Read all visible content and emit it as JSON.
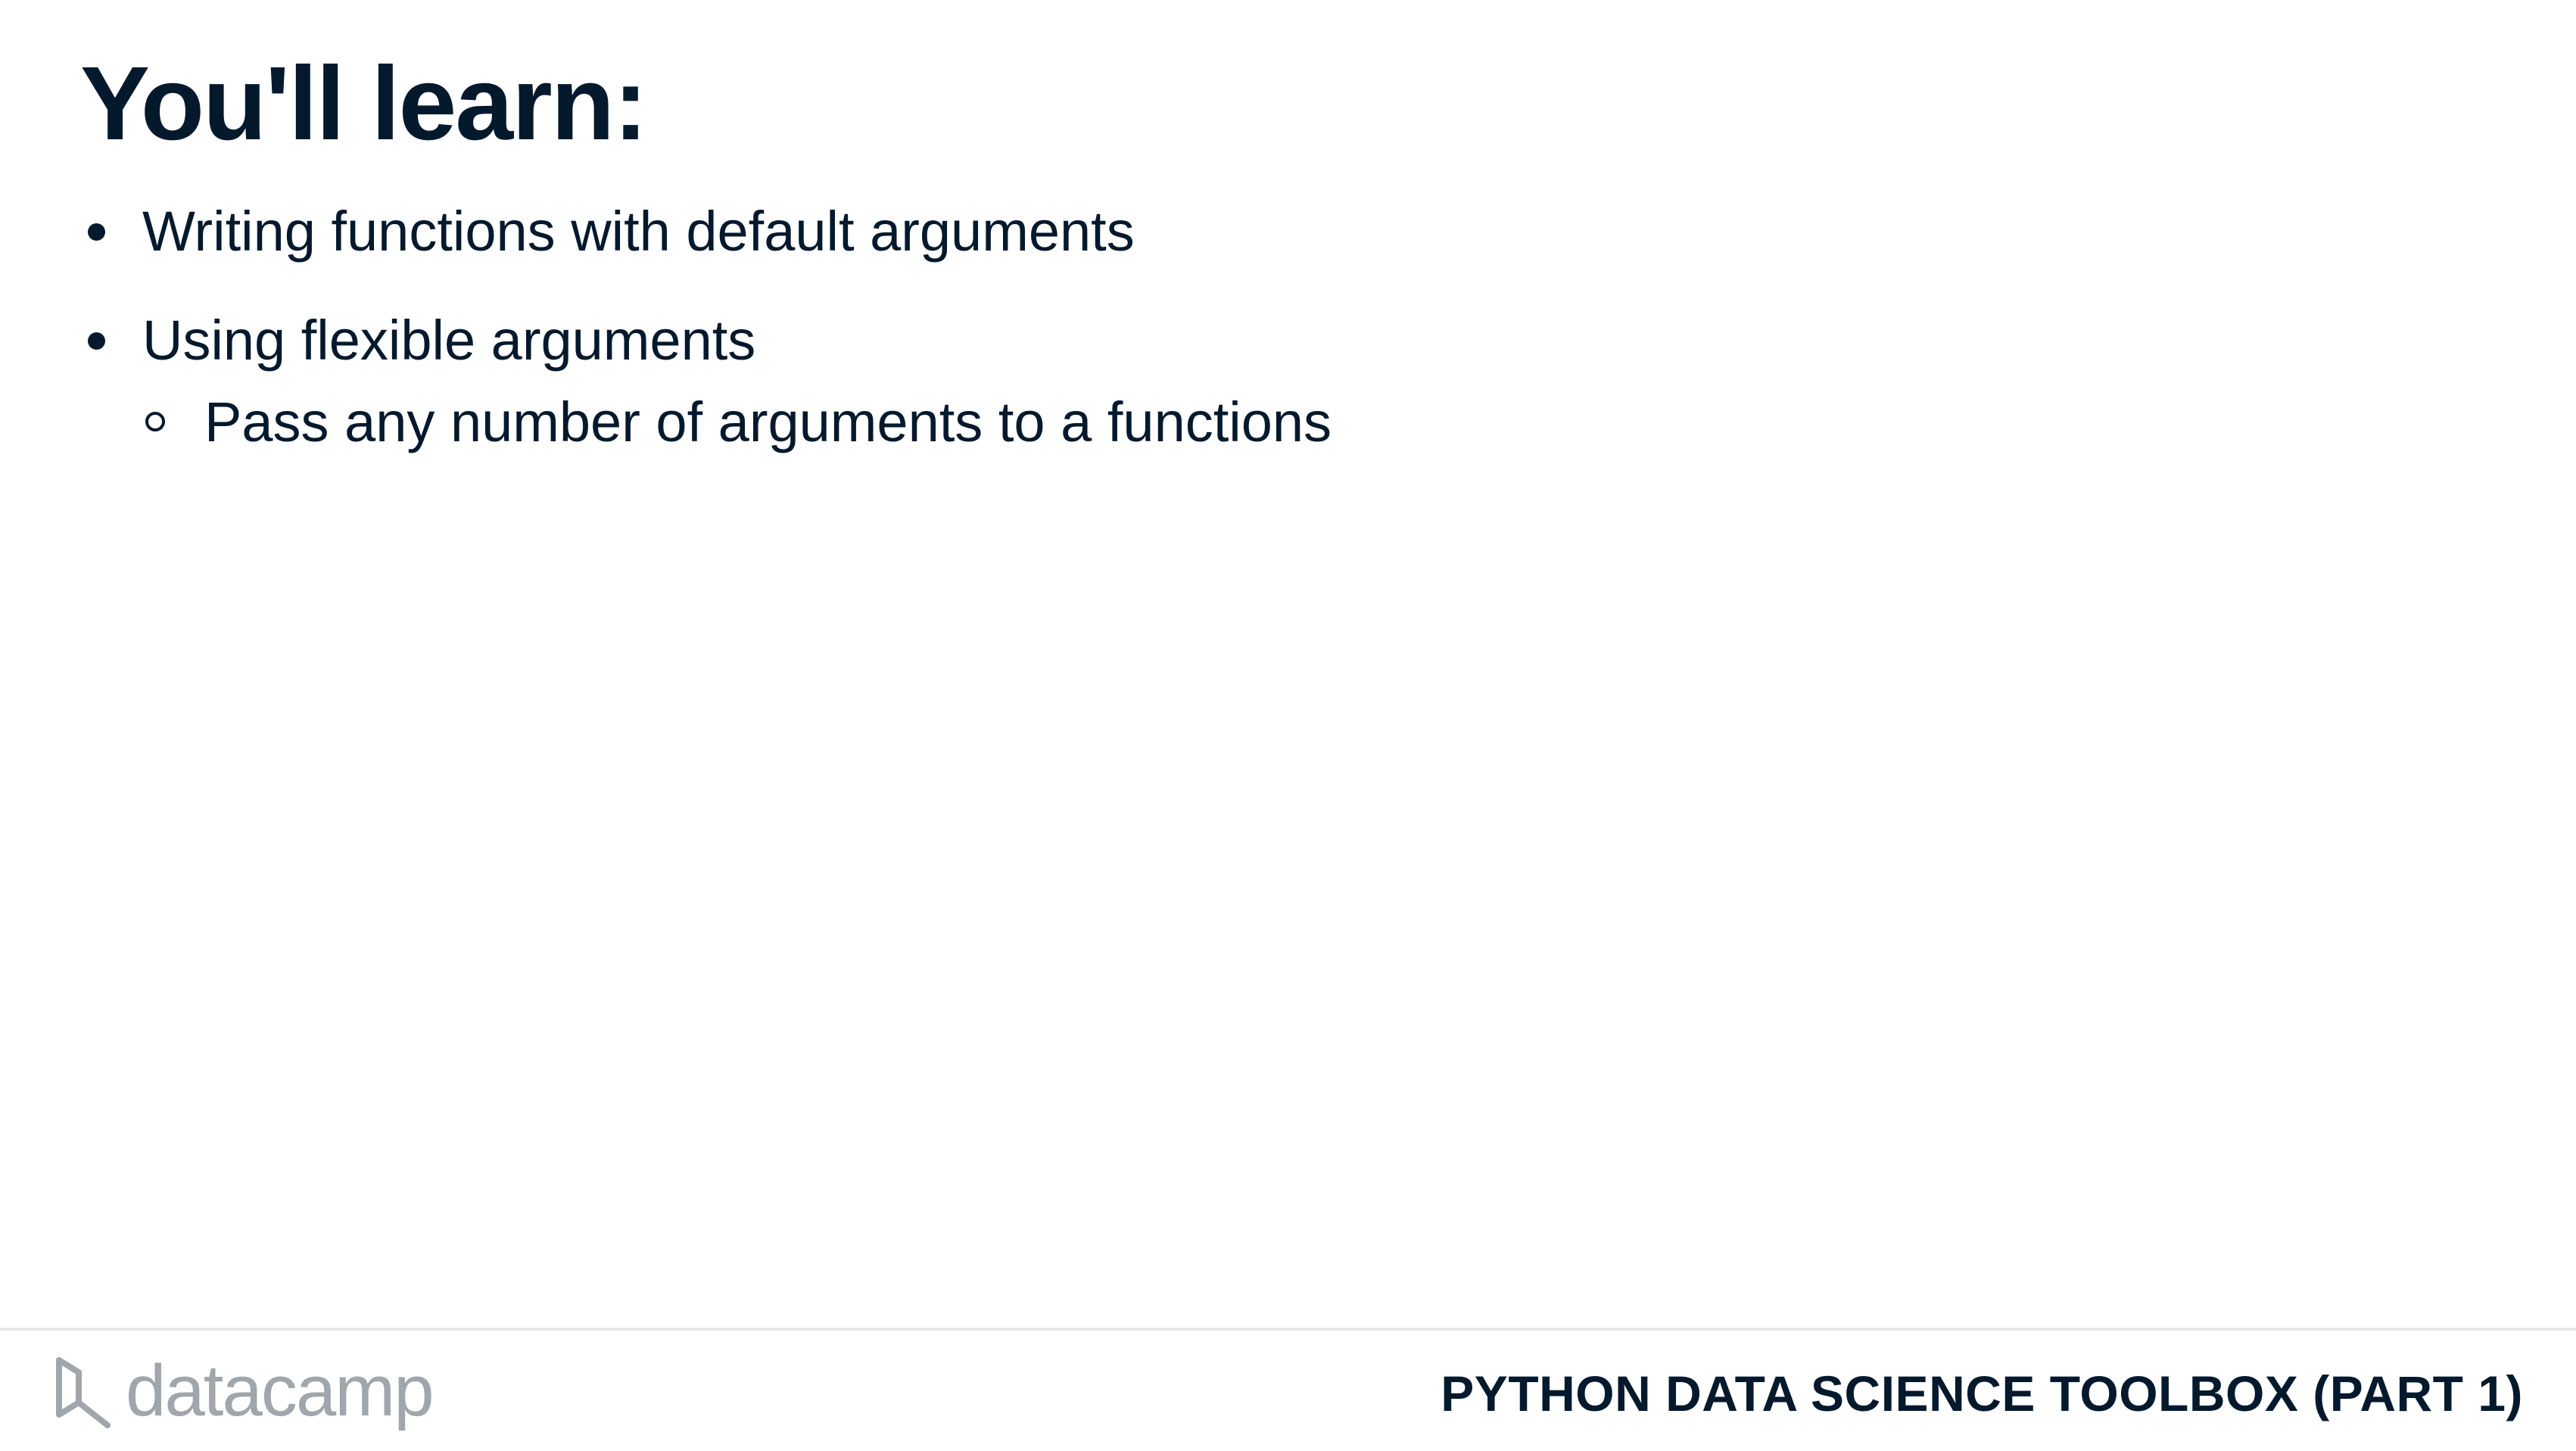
{
  "slide": {
    "title": "You'll learn:",
    "bullets": [
      {
        "text": "Writing functions with default arguments",
        "sub_items": []
      },
      {
        "text": "Using flexible arguments",
        "sub_items": [
          {
            "text": "Pass any number of arguments to a functions"
          }
        ]
      }
    ]
  },
  "footer": {
    "logo_text": "datacamp",
    "logo_icon": "datacamp-logo-icon",
    "course_title": "PYTHON DATA SCIENCE TOOLBOX (PART 1)"
  },
  "colors": {
    "text": "#05192d",
    "logo_gray": "#a0a6ab",
    "rule": "#e6e8ea",
    "background": "#ffffff"
  }
}
